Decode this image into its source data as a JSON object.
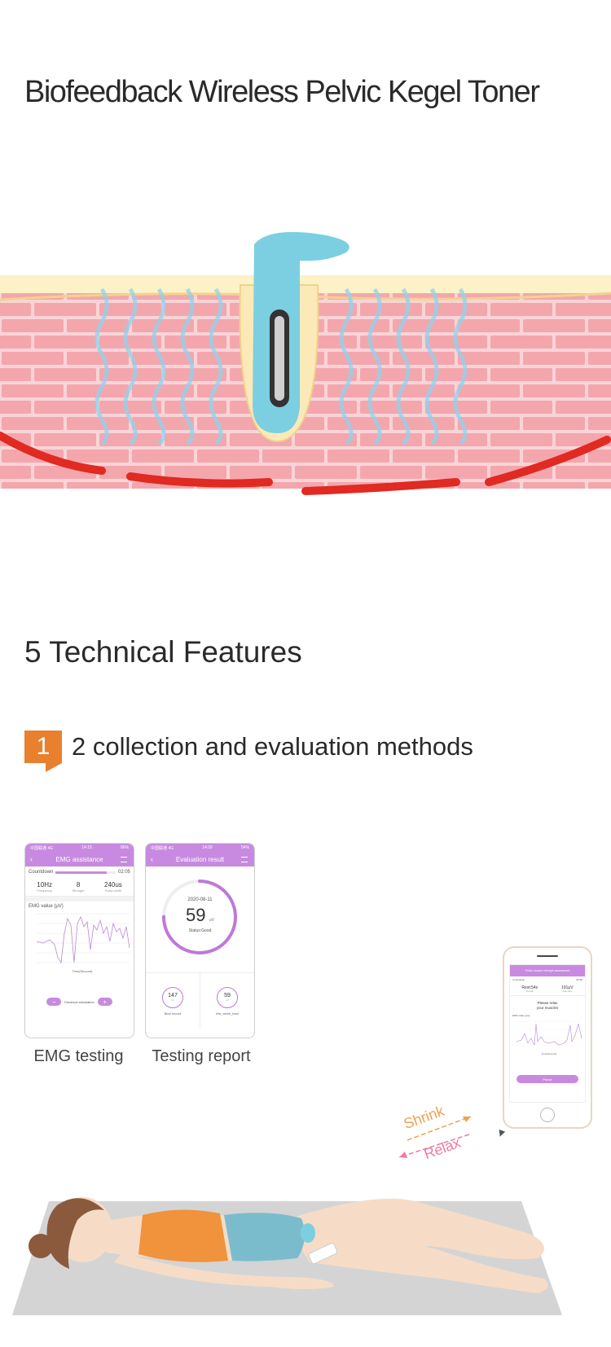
{
  "page_title": "Biofeedback Wireless Pelvic Kegel Toner",
  "section_title": "5 Technical Features",
  "feature": {
    "number": "1",
    "text": "2 collection and evaluation methods"
  },
  "emg_phone": {
    "status_left": "中国联通 4G",
    "status_time": "14:15",
    "status_right": "86%",
    "header": "EMG assistance",
    "countdown_label": "Countdown",
    "countdown_value": "02:05",
    "countdown_progress": 0.85,
    "params": [
      {
        "value": "10Hz",
        "label": "Frequency"
      },
      {
        "value": "8",
        "label": "Strength"
      },
      {
        "value": "240us",
        "label": "Pulse width"
      }
    ],
    "chart_label": "EMG value (μV)",
    "time_label": "Time(Second)",
    "control_label": "Electrical stimulation",
    "minus": "−",
    "plus": "+"
  },
  "report_phone": {
    "status_left": "中国联通 4G",
    "status_time": "14:09",
    "status_right": "54%",
    "header": "Evaluation result",
    "date": "2020-08-11",
    "score": "59",
    "unit": "uV",
    "status_text": "Status:Good",
    "score_fraction": 0.75,
    "stats": [
      {
        "value": "147",
        "unit": "uV",
        "label": "Best record"
      },
      {
        "value": "59",
        "unit": "uV",
        "label": "this_week_best"
      }
    ]
  },
  "captions": {
    "emg": "EMG testing",
    "report": "Testing report"
  },
  "side_phone": {
    "header": "Pelvic muscle strength assessment",
    "countdown_label": "Countdown",
    "countdown_value": "00:50",
    "rest_label": "Rest:54s",
    "rest_sub": "Strength",
    "value": "191μV",
    "value_sub": "Peak value",
    "prompt_line1": "Please relax",
    "prompt_line2": "your muscles",
    "chart_label": "EMG value (μV)",
    "time_label": "Time(Second)",
    "button": "Pause"
  },
  "arrows": {
    "shrink": "Shrink",
    "relax": "Relax"
  },
  "colors": {
    "accent": "#e8802e",
    "app_purple": "#c88ae0",
    "device_blue": "#7ccfe0",
    "muscle_pink": "#f5c4c8"
  }
}
